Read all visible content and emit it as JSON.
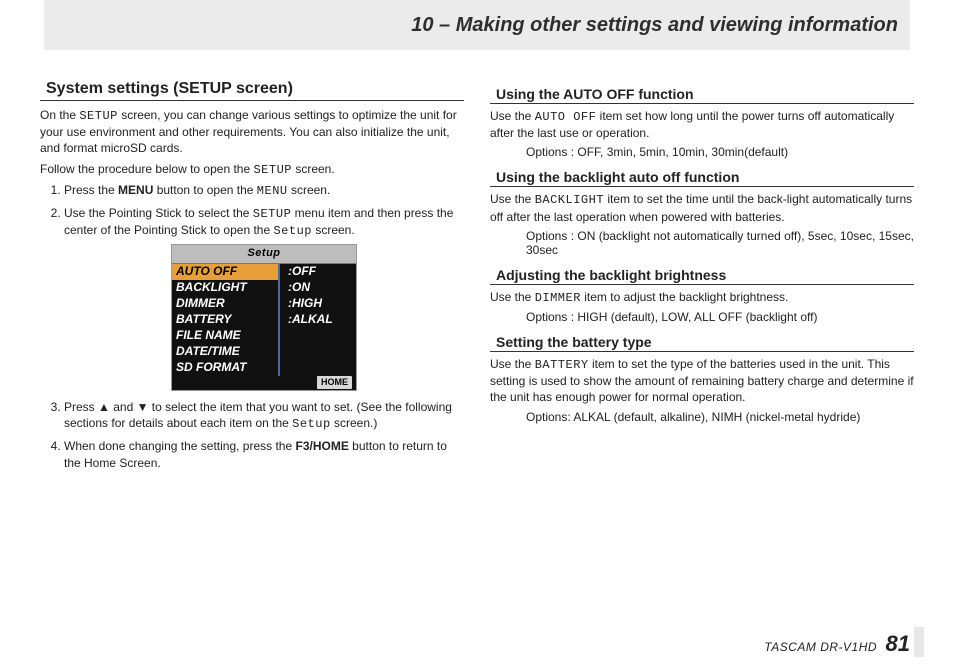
{
  "chapter_title": "10 – Making other settings and viewing information",
  "left": {
    "h2": "System settings (SETUP screen)",
    "p1a": "On the ",
    "p1mono": "SETUP",
    "p1b": " screen, you can change various settings to optimize the unit for your use environment and other requirements. You can also initialize the unit, and format microSD cards.",
    "p2a": "Follow the procedure below to open the ",
    "p2mono": "SETUP",
    "p2b": " screen.",
    "li1a": "Press the ",
    "li1bold": "MENU",
    "li1b": " button to open the ",
    "li1mono": "MENU",
    "li1c": " screen.",
    "li2a": "Use the Pointing Stick to select the ",
    "li2mono": "SETUP",
    "li2b": " menu item and then press the center of the Pointing Stick to open the ",
    "li2mono2": "Setup",
    "li2c": " screen.",
    "lcd": {
      "title": "Setup",
      "rows": [
        {
          "l": "AUTO OFF",
          "r": ":OFF",
          "sel": true
        },
        {
          "l": "BACKLIGHT",
          "r": ":ON",
          "sel": false
        },
        {
          "l": "DIMMER",
          "r": ":HIGH",
          "sel": false
        },
        {
          "l": "BATTERY",
          "r": ":ALKAL",
          "sel": false
        },
        {
          "l": "FILE NAME",
          "r": "",
          "sel": false
        },
        {
          "l": "DATE/TIME",
          "r": "",
          "sel": false
        },
        {
          "l": "SD FORMAT",
          "r": "",
          "sel": false
        }
      ],
      "bottom_tag": "HOME"
    },
    "li3a": "Press ▲ and ▼ to select the item that you want to set. (See the following sections for details about each item on the ",
    "li3mono": "Setup",
    "li3b": " screen.)",
    "li4a": "When done changing the setting, press the ",
    "li4bold": "F3/HOME",
    "li4b": " button to return to the Home Screen."
  },
  "right": {
    "s1": {
      "h3": "Using the AUTO OFF function",
      "pa": "Use the ",
      "pmono": "AUTO OFF",
      "pb": " item set how long until the power turns off automatically after the last use or operation.",
      "opts": "Options : OFF, 3min, 5min, 10min, 30min(default)"
    },
    "s2": {
      "h3": "Using the backlight auto off function",
      "pa": "Use the ",
      "pmono": "BACKLIGHT",
      "pb": " item to set the time until the back-light automatically turns off after the last operation when powered with batteries.",
      "opts": "Options : ON (backlight not automatically turned off), 5sec, 10sec, 15sec, 30sec"
    },
    "s3": {
      "h3": "Adjusting the backlight brightness",
      "pa": "Use the ",
      "pmono": "DIMMER",
      "pb": " item to adjust the backlight brightness.",
      "opts": "Options : HIGH (default), LOW, ALL OFF (backlight off)"
    },
    "s4": {
      "h3": "Setting the battery type",
      "pa": "Use the ",
      "pmono": "BATTERY",
      "pb": " item to set the type of the batteries used in the unit. This setting is used to show the amount of remaining battery charge and determine if the unit has enough power for normal operation.",
      "opts": "Options: ALKAL (default, alkaline), NIMH (nickel-metal hydride)"
    }
  },
  "footer": {
    "brand": "TASCAM  DR-V1HD",
    "page": "81"
  }
}
